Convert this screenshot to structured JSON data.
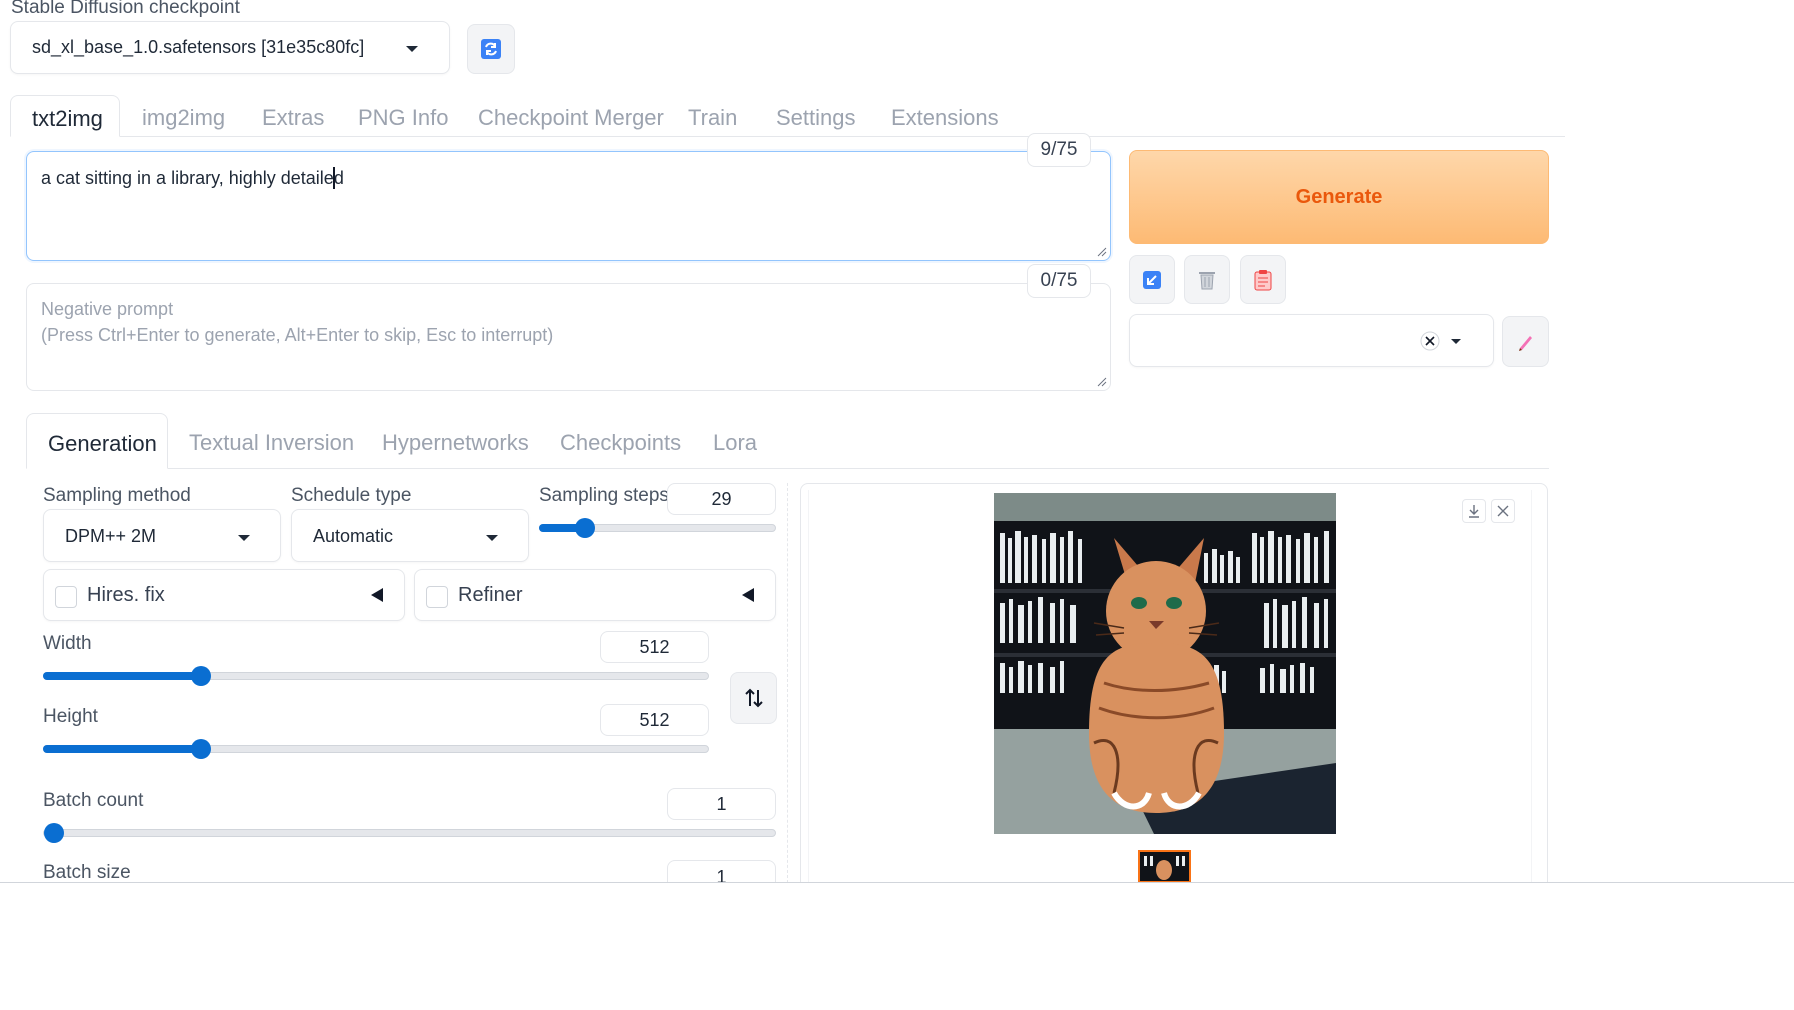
{
  "checkpoint": {
    "label": "Stable Diffusion checkpoint",
    "value": "sd_xl_base_1.0.safetensors [31e35c80fc]"
  },
  "main_tabs": [
    "txt2img",
    "img2img",
    "Extras",
    "PNG Info",
    "Checkpoint Merger",
    "Train",
    "Settings",
    "Extensions"
  ],
  "prompt": {
    "value": "a cat sitting in a library, highly detailed",
    "counter": "9/75"
  },
  "negative_prompt": {
    "placeholder_line1": "Negative prompt",
    "placeholder_line2": "(Press Ctrl+Enter to generate, Alt+Enter to skip, Esc to interrupt)",
    "counter": "0/75"
  },
  "generate": {
    "label": "Generate"
  },
  "sub_tabs": [
    "Generation",
    "Textual Inversion",
    "Hypernetworks",
    "Checkpoints",
    "Lora"
  ],
  "sampling": {
    "method_label": "Sampling method",
    "method_value": "DPM++ 2M",
    "schedule_label": "Schedule type",
    "schedule_value": "Automatic",
    "steps_label": "Sampling steps",
    "steps_value": "29",
    "steps_fraction": 0.19
  },
  "hires": {
    "label": "Hires. fix"
  },
  "refiner": {
    "label": "Refiner"
  },
  "width": {
    "label": "Width",
    "value": "512",
    "fraction": 0.235
  },
  "height": {
    "label": "Height",
    "value": "512",
    "fraction": 0.235
  },
  "batch_count": {
    "label": "Batch count",
    "value": "1",
    "fraction": 0.0
  },
  "batch_size": {
    "label": "Batch size",
    "value": "1"
  },
  "colors": {
    "accent": "#0a6ed1",
    "generate_text": "#ea580c",
    "generate_bg_top": "#fed7aa",
    "generate_bg_bottom": "#fdba74"
  }
}
